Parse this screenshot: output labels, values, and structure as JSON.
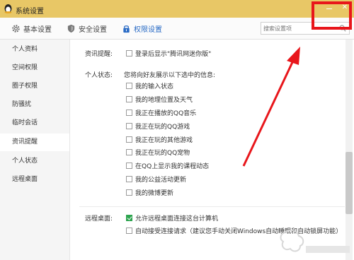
{
  "window": {
    "title": "系统设置"
  },
  "tabs": [
    {
      "label": "基本设置",
      "icon": "gear-icon"
    },
    {
      "label": "安全设置",
      "icon": "shield-icon"
    },
    {
      "label": "权限设置",
      "icon": "lock-icon",
      "active": true
    }
  ],
  "search": {
    "placeholder": "搜索设置项"
  },
  "sidebar": {
    "items": [
      {
        "label": "个人资料"
      },
      {
        "label": "空间权限"
      },
      {
        "label": "圈子权限"
      },
      {
        "label": "防骚扰"
      },
      {
        "label": "临时会话"
      },
      {
        "label": "资讯提醒",
        "active": true
      },
      {
        "label": "个人状态"
      },
      {
        "label": "远程桌面"
      }
    ]
  },
  "content": {
    "news": {
      "label": "资讯提醒:",
      "option": "登录后显示\"腾讯网迷你版\"",
      "checked": false
    },
    "status": {
      "label": "个人状态:",
      "desc": "您将向好友展示以下选中的信息:",
      "options": [
        {
          "label": "我的输入状态",
          "checked": false
        },
        {
          "label": "我的地理位置及天气",
          "checked": false
        },
        {
          "label": "我正在播放的QQ音乐",
          "checked": false
        },
        {
          "label": "我正在玩的QQ游戏",
          "checked": false
        },
        {
          "label": "我正在玩的其他游戏",
          "checked": false
        },
        {
          "label": "我正在玩的QQ宠物",
          "checked": false
        },
        {
          "label": "在QQ上显示我的课程动态",
          "checked": false
        },
        {
          "label": "我的公益活动更新",
          "checked": false
        },
        {
          "label": "我的微博更新",
          "checked": false
        }
      ]
    },
    "remote": {
      "label": "远程桌面:",
      "options": [
        {
          "label": "允许远程桌面连接这台计算机",
          "checked": true
        },
        {
          "label": "自动接受连接请求（建议您手动关闭Windows自动睡眠和自动锁屏功能）",
          "checked": false
        }
      ]
    }
  },
  "colors": {
    "titlebar": "#e8c766",
    "accent": "#2a6bc5",
    "checked": "#2ea44f",
    "annotation": "#e8161b"
  }
}
